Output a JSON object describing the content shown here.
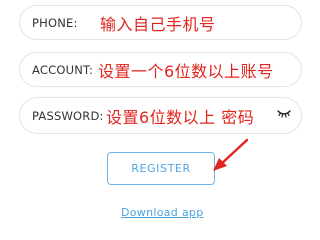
{
  "form": {
    "phone": {
      "label": "PHONE:",
      "note": "输入自己手机号"
    },
    "account": {
      "label": "ACCOUNT:",
      "note": "设置一个6位数以上账号"
    },
    "password": {
      "label": "PASSWORD:",
      "note": "设置6位数以上 密码",
      "toggle_icon": "eye-closed-icon"
    }
  },
  "actions": {
    "register_label": "REGISTER",
    "download_label": "Download app"
  },
  "colors": {
    "note_red": "#e3241d",
    "accent_blue": "#4ea5e2",
    "field_border": "#e3e3e3"
  }
}
